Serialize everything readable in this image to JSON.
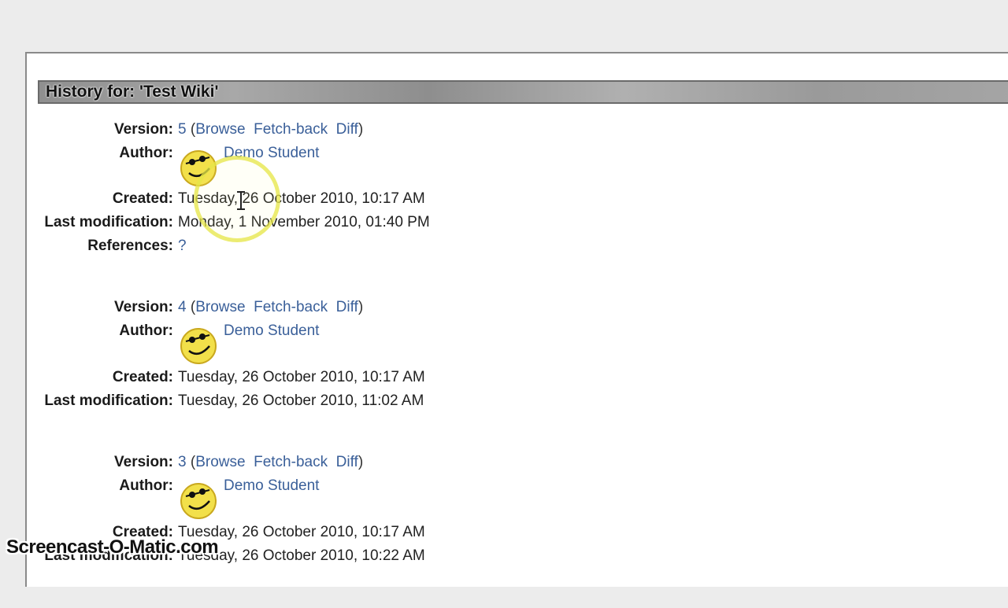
{
  "page": {
    "history_title": "History for: 'Test Wiki'",
    "watermark": "Screencast-O-Matic.com"
  },
  "labels": {
    "version": "Version:",
    "author": "Author:",
    "created": "Created:",
    "last_modification": "Last modification:",
    "references": "References:"
  },
  "link_labels": {
    "open_paren": "(",
    "browse": "Browse",
    "fetch_back": "Fetch-back",
    "diff": "Diff",
    "close_paren": ")"
  },
  "versions": [
    {
      "number": "5",
      "author": "Demo Student",
      "created": "Tuesday, 26 October 2010, 10:17 AM",
      "last_modification": "Monday, 1 November 2010, 01:40 PM",
      "references": "?"
    },
    {
      "number": "4",
      "author": "Demo Student",
      "created": "Tuesday, 26 October 2010, 10:17 AM",
      "last_modification": "Tuesday, 26 October 2010, 11:02 AM"
    },
    {
      "number": "3",
      "author": "Demo Student",
      "created": "Tuesday, 26 October 2010, 10:17 AM",
      "last_modification": "Tuesday, 26 October 2010, 10:22 AM"
    }
  ],
  "colors": {
    "link": "#3a5f99",
    "header_bar": "#9a9a9a",
    "background": "#ececec"
  }
}
